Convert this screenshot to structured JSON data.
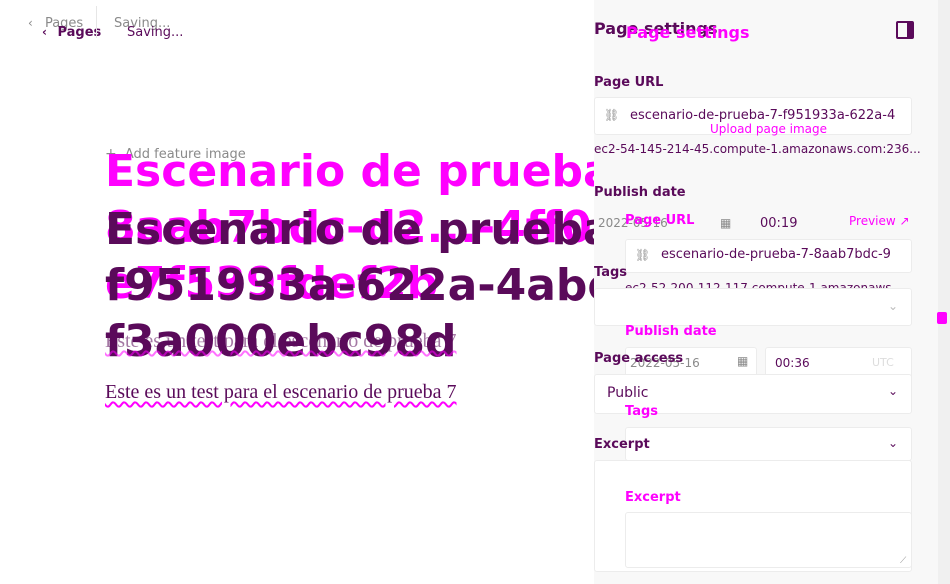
{
  "topbar": {
    "back_label": "Pages",
    "status": "Saving..."
  },
  "editor": {
    "add_feature_image": "Add feature image",
    "title_magenta": [
      "Escenario de prueba 7",
      "8aab7bdc-d2...-4ff0-b",
      "e7f539fdef2b"
    ],
    "title_purple": [
      "Escenario de prueba",
      "f951933a-622a-4abc-",
      "f3a000ebc98d"
    ],
    "body_text": "Este es un test para el escenario de prueba 7",
    "upload_page_image": "Upload page image"
  },
  "sidebar": {
    "header_title": "Page settings",
    "page_url_label": "Page URL",
    "page_url_value_a": "escenario-de-prueba-7-f951933a-622a-4",
    "page_url_value_b": "escenario-de-prueba-7-8aab7bdc-9",
    "page_url_host_a": "ec2-54-145-214-45.compute-1.amazonaws.com:236...",
    "page_url_host_b": "ec2-52-200-112-117.compute-1.amazonaws....",
    "preview_label": "Preview",
    "publish_date_label": "Publish date",
    "publish_date_a": "2022-05-16",
    "publish_time_a": "00:19",
    "publish_date_b": "2022-05-16",
    "publish_time_b": "00:36",
    "tags_label": "Tags",
    "page_access_label": "Page access",
    "page_access_value": "Public",
    "excerpt_label": "Excerpt",
    "timezone_hint": "UTC"
  },
  "colors": {
    "magenta": "#ff00ff",
    "purple": "#5a0a5a",
    "ghost": "#8a8a8a",
    "panel_bg": "#f8f8f8"
  }
}
